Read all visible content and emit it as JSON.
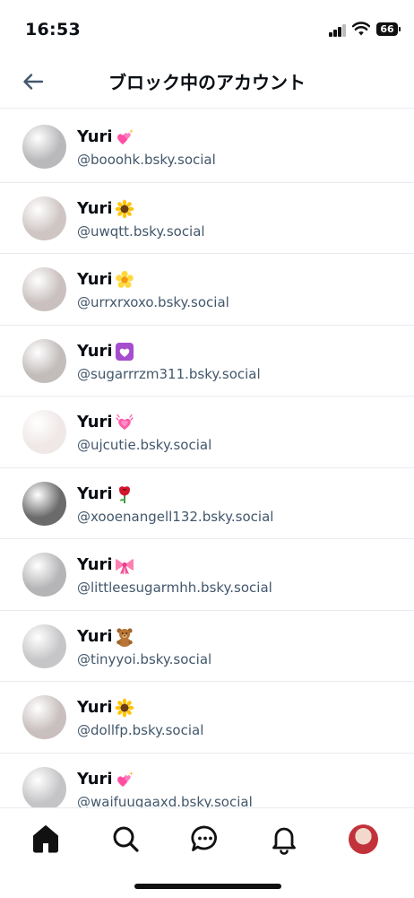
{
  "status": {
    "time": "16:53",
    "battery": "66"
  },
  "header": {
    "title": "ブロック中のアカウント"
  },
  "accounts": [
    {
      "name": "Yuri",
      "emoji": "heart-sparkle-icon",
      "handle": "@booohk.bsky.social",
      "avatar_color": "#b9b9bb"
    },
    {
      "name": "Yuri",
      "emoji": "sunflower-icon",
      "handle": "@uwqtt.bsky.social",
      "avatar_color": "#cfc6c4"
    },
    {
      "name": "Yuri",
      "emoji": "blossom-icon",
      "handle": "@urrxrxoxo.bsky.social",
      "avatar_color": "#c9c0bf"
    },
    {
      "name": "Yuri",
      "emoji": "heart-box-icon",
      "handle": "@sugarrrzm311.bsky.social",
      "avatar_color": "#c2bcbb"
    },
    {
      "name": "Yuri",
      "emoji": "growing-heart-icon",
      "handle": "@ujcutie.bsky.social",
      "avatar_color": "#efe8e7"
    },
    {
      "name": "Yuri",
      "emoji": "rose-icon",
      "handle": "@xooenangell132.bsky.social",
      "avatar_color": "#6b6b6b"
    },
    {
      "name": "Yuri",
      "emoji": "ribbon-icon",
      "handle": "@littleesugarmhh.bsky.social",
      "avatar_color": "#b5b5b7"
    },
    {
      "name": "Yuri",
      "emoji": "teddy-bear-icon",
      "handle": "@tinyyoi.bsky.social",
      "avatar_color": "#c6c6c8"
    },
    {
      "name": "Yuri",
      "emoji": "sunflower-icon",
      "handle": "@dollfp.bsky.social",
      "avatar_color": "#c8bfbe"
    },
    {
      "name": "Yuri",
      "emoji": "heart-sparkle-icon",
      "handle": "@waifuugaaxd.bsky.social",
      "avatar_color": "#c4c4c6"
    }
  ],
  "tabbar": {
    "items": [
      "home-icon",
      "search-icon",
      "chat-icon",
      "bell-icon",
      "profile-avatar"
    ]
  },
  "colors": {
    "text": "#0b0f14",
    "handle": "#42576c",
    "divider": "#e8ecef",
    "back_arrow": "#42576c"
  }
}
